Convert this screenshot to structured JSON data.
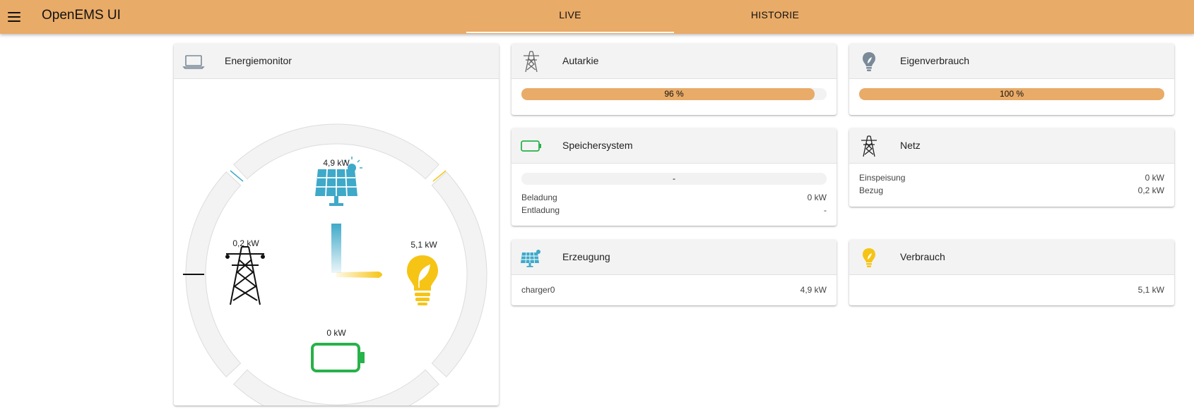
{
  "app": {
    "title": "OpenEMS UI"
  },
  "tabs": [
    {
      "label": "LIVE"
    },
    {
      "label": "HISTORIE"
    }
  ],
  "monitor": {
    "title": "Energiemonitor",
    "production": "4,9 kW",
    "grid": "0,2 kW",
    "consumption": "5,1 kW",
    "storage": "0 kW"
  },
  "autarkie": {
    "title": "Autarkie",
    "percent": 96,
    "label": "96 %"
  },
  "eigenverbrauch": {
    "title": "Eigenverbrauch",
    "percent": 100,
    "label": "100 %"
  },
  "speicher": {
    "title": "Speichersystem",
    "bar_label": "-",
    "rows": [
      {
        "label": "Beladung",
        "value": "0 kW"
      },
      {
        "label": "Entladung",
        "value": "-"
      }
    ]
  },
  "netz": {
    "title": "Netz",
    "rows": [
      {
        "label": "Einspeisung",
        "value": "0 kW"
      },
      {
        "label": "Bezug",
        "value": "0,2 kW"
      }
    ]
  },
  "erzeugung": {
    "title": "Erzeugung",
    "row": {
      "label": "charger0",
      "value": "4,9 kW"
    }
  },
  "verbrauch": {
    "title": "Verbrauch",
    "value": "5,1 kW"
  },
  "colors": {
    "accent": "#e9ab68",
    "production": "#3fa9c9",
    "consumption": "#f6c415",
    "storage": "#27b24a",
    "grid": "#111111"
  },
  "icons": {
    "menu": "menu-icon",
    "monitor": "laptop-icon",
    "autarkie": "power-tower-icon",
    "eigenverbrauch": "lightbulb-icon",
    "speicher": "battery-icon",
    "netz": "power-tower-icon",
    "erzeugung": "solar-panel-icon",
    "verbrauch": "lightbulb-icon"
  }
}
